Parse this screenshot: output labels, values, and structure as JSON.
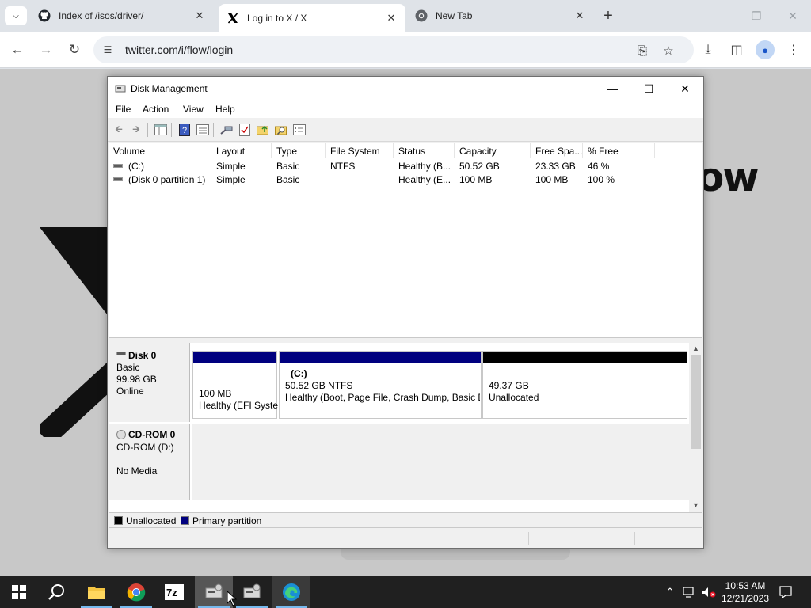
{
  "browser": {
    "tabs": [
      {
        "title": "Index of /isos/driver/",
        "favicon": "github-icon",
        "active": false
      },
      {
        "title": "Log in to X / X",
        "favicon": "x-logo-icon",
        "active": true
      },
      {
        "title": "New Tab",
        "favicon": "chrome-icon",
        "active": false
      }
    ],
    "url": "twitter.com/i/flow/login"
  },
  "page_bg": {
    "partial_text": "ow"
  },
  "disk_management": {
    "title": "Disk Management",
    "menu": [
      "File",
      "Action",
      "View",
      "Help"
    ],
    "columns": [
      "Volume",
      "Layout",
      "Type",
      "File System",
      "Status",
      "Capacity",
      "Free Spa...",
      "% Free"
    ],
    "volumes": [
      {
        "volume": "(C:)",
        "layout": "Simple",
        "type": "Basic",
        "fs": "NTFS",
        "status": "Healthy (B...",
        "capacity": "50.52 GB",
        "free": "23.33 GB",
        "pct": "46 %"
      },
      {
        "volume": "(Disk 0 partition 1)",
        "layout": "Simple",
        "type": "Basic",
        "fs": "",
        "status": "Healthy (E...",
        "capacity": "100 MB",
        "free": "100 MB",
        "pct": "100 %"
      }
    ],
    "disk0": {
      "name": "Disk 0",
      "type": "Basic",
      "size": "99.98 GB",
      "state": "Online",
      "partitions": [
        {
          "line1": "",
          "line2": "100 MB",
          "line3": "Healthy (EFI Syste",
          "kind": "primary"
        },
        {
          "line1": "(C:)",
          "line2": "50.52 GB NTFS",
          "line3": "Healthy (Boot, Page File, Crash Dump, Basic D",
          "kind": "primary"
        },
        {
          "line1": "",
          "line2": "49.37 GB",
          "line3": "Unallocated",
          "kind": "unallocated"
        }
      ]
    },
    "cdrom0": {
      "name": "CD-ROM 0",
      "drive": "CD-ROM (D:)",
      "media": "No Media"
    },
    "legend": [
      {
        "label": "Unallocated",
        "color": "#000000"
      },
      {
        "label": "Primary partition",
        "color": "#00007f"
      }
    ]
  },
  "taskbar": {
    "time": "10:53 AM",
    "date": "12/21/2023"
  },
  "colors": {
    "primary_partition": "#00007f",
    "unallocated": "#000000",
    "taskbar": "#202020"
  }
}
